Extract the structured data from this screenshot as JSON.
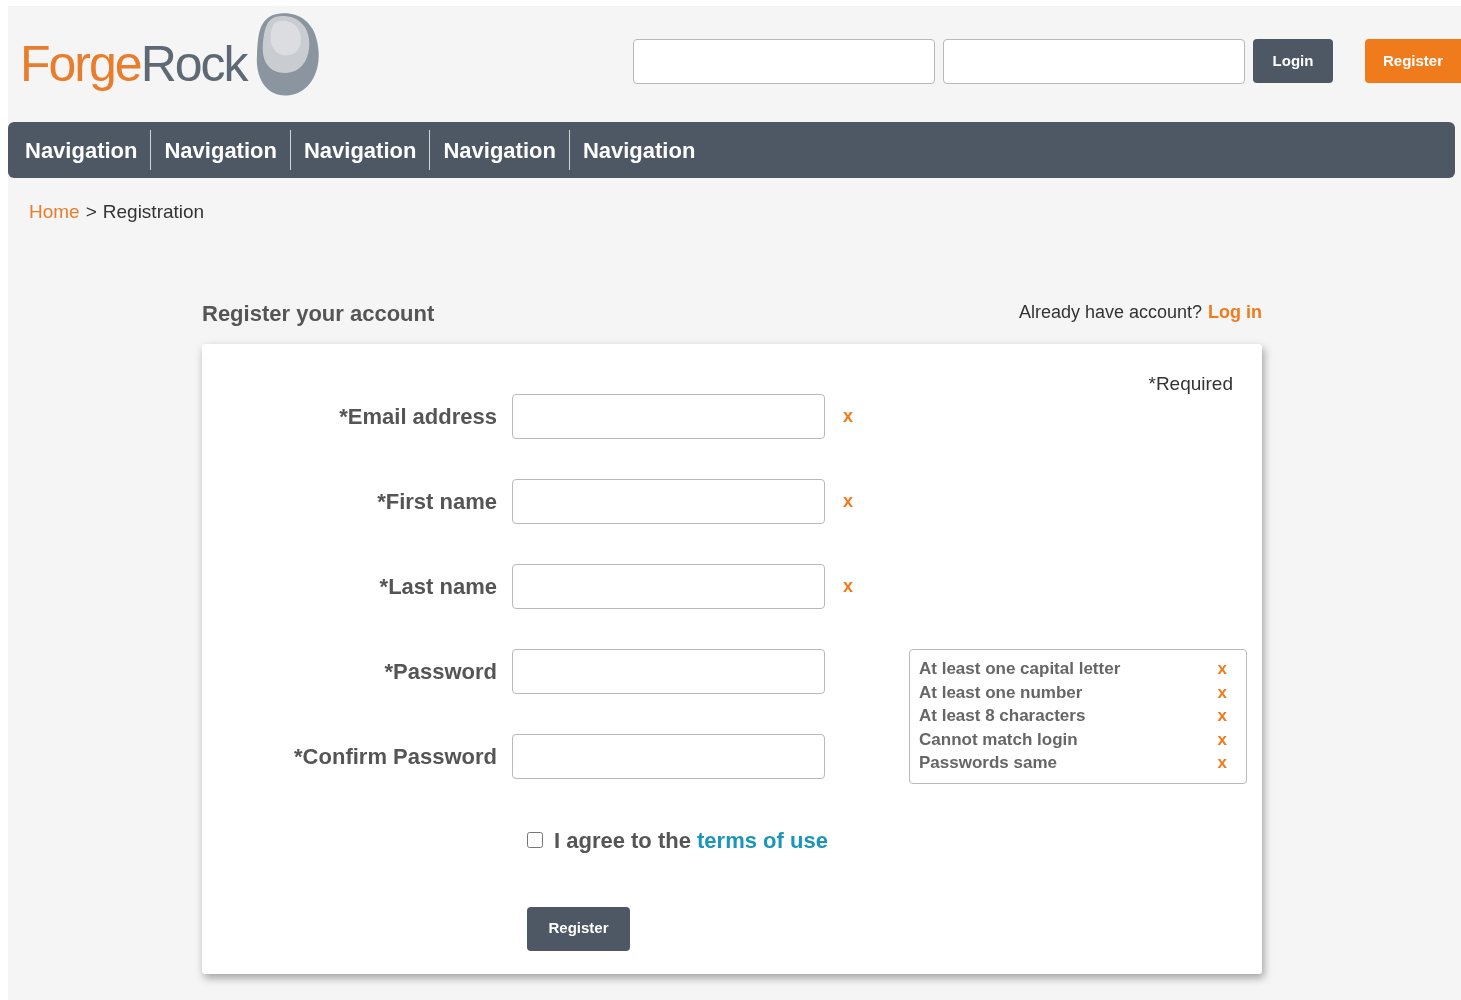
{
  "logo": {
    "text_1": "Forge",
    "text_2": "Rock"
  },
  "header": {
    "login_button": "Login",
    "register_button": "Register"
  },
  "nav": [
    "Navigation",
    "Navigation",
    "Navigation",
    "Navigation",
    "Navigation"
  ],
  "breadcrumb": {
    "home": "Home",
    "separator": ">",
    "current": "Registration"
  },
  "title": "Register your account",
  "login_prompt": {
    "text": "Already have account?",
    "link": "Log in"
  },
  "required_note": "*Required",
  "fields": [
    {
      "label": "*Email address",
      "marker": "x"
    },
    {
      "label": "*First name",
      "marker": "x"
    },
    {
      "label": "*Last name",
      "marker": "x"
    },
    {
      "label": "*Password"
    },
    {
      "label": "*Confirm Password"
    }
  ],
  "requirements": [
    {
      "text": "At least one capital letter",
      "marker": "x"
    },
    {
      "text": "At least one number",
      "marker": "x"
    },
    {
      "text": "At least 8 characters",
      "marker": "x"
    },
    {
      "text": "Cannot match login",
      "marker": "x"
    },
    {
      "text": "Passwords same",
      "marker": "x"
    }
  ],
  "agree": {
    "checked": false,
    "text": "I agree to the",
    "link": "terms of use"
  },
  "submit": "Register"
}
